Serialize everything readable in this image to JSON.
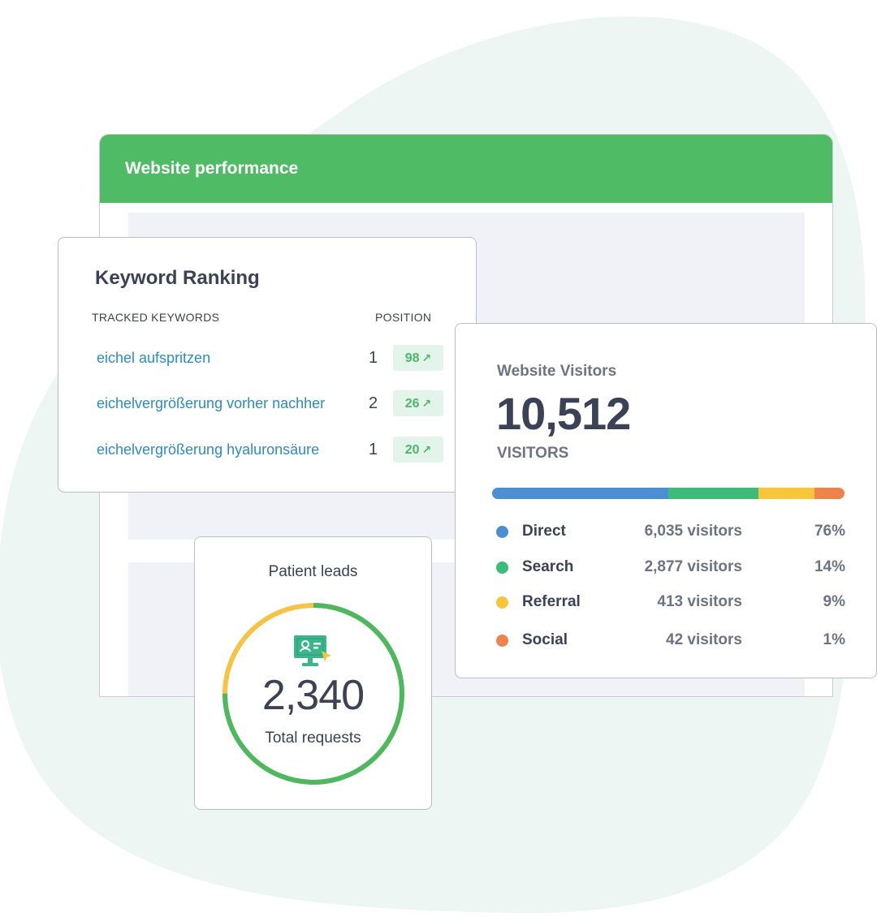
{
  "window": {
    "title": "Website performance"
  },
  "keyword_ranking": {
    "title": "Keyword Ranking",
    "col_keywords": "TRACKED KEYWORDS",
    "col_position": "POSITION",
    "rows": [
      {
        "keyword": "eichel aufspritzen",
        "position": "1",
        "change": "98"
      },
      {
        "keyword": "eichelvergrößerung vorher nachher",
        "position": "2",
        "change": "26"
      },
      {
        "keyword": "eichelvergrößerung hyaluronsäure",
        "position": "1",
        "change": "20"
      }
    ],
    "arrow_icon": "arrow-up-right-icon"
  },
  "visitors": {
    "title": "Website Visitors",
    "total": "10,512",
    "label": "VISITORS",
    "sources": [
      {
        "name": "Direct",
        "count": "6,035 visitors",
        "percent": "76%",
        "color": "#4a8fd4",
        "share": 0.5
      },
      {
        "name": "Search",
        "count": "2,877 visitors",
        "percent": "14%",
        "color": "#3dbb78",
        "share": 0.255
      },
      {
        "name": "Referral",
        "count": "413 visitors",
        "percent": "9%",
        "color": "#f9c53a",
        "share": 0.16
      },
      {
        "name": "Social",
        "count": "42 visitors",
        "percent": "1%",
        "color": "#f0834b",
        "share": 0.085
      }
    ]
  },
  "patient_leads": {
    "title": "Patient leads",
    "total": "2,340",
    "subtitle": "Total requests",
    "ring_progress": 0.75,
    "ring_color": "#4cb860",
    "ring_remainder_color": "#f6c444",
    "icon": "monitor-user-icon"
  },
  "colors": {
    "header_green": "#4fbb64",
    "blob": "#eef6f3",
    "link_blue": "#2a8cc4",
    "badge_bg": "#e3f5ea",
    "badge_text": "#4cb869"
  }
}
